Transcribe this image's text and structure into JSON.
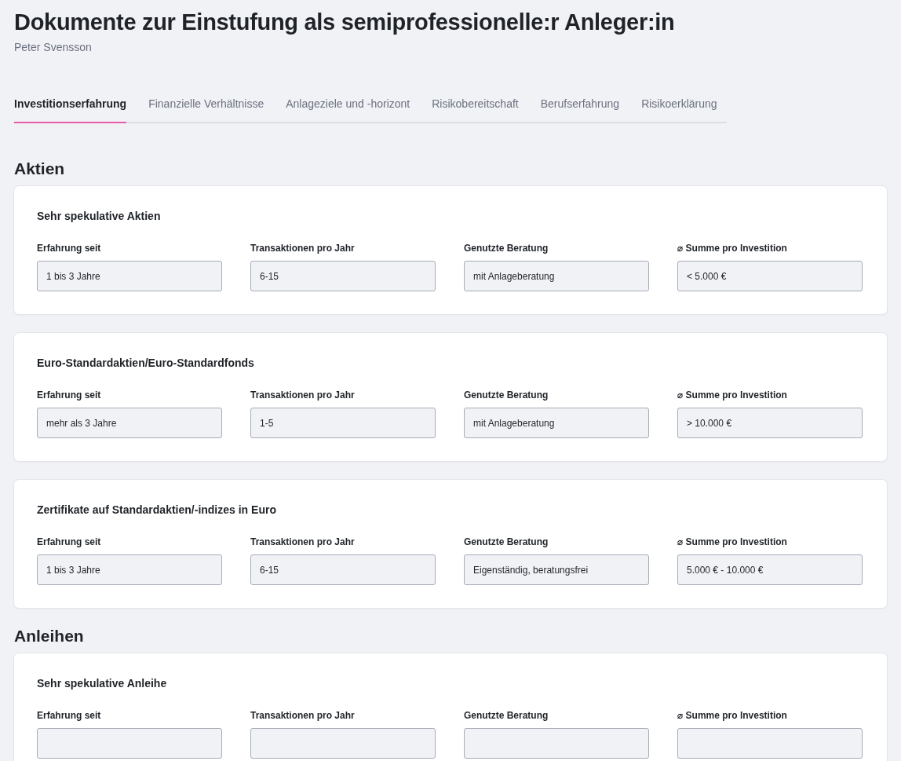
{
  "title": "Dokumente zur Einstufung als semiprofessionelle:r Anleger:in",
  "subtitle": "Peter Svensson",
  "tabs": [
    {
      "label": "Investitionserfahrung",
      "selected": true
    },
    {
      "label": "Finanzielle Verhältnisse",
      "selected": false
    },
    {
      "label": "Anlageziele und -horizont",
      "selected": false
    },
    {
      "label": "Risikobereitschaft",
      "selected": false
    },
    {
      "label": "Berufserfahrung",
      "selected": false
    },
    {
      "label": "Risikoerklärung",
      "selected": false
    }
  ],
  "sections": [
    {
      "heading": "Aktien",
      "cards": [
        {
          "title": "Sehr spekulative Aktien",
          "fields": [
            {
              "label": "Erfahrung seit",
              "value": "1 bis 3 Jahre"
            },
            {
              "label": "Transaktionen pro Jahr",
              "value": "6-15"
            },
            {
              "label": "Genutzte Beratung",
              "value": "mit Anlageberatung"
            },
            {
              "label": "⌀ Summe pro Investition",
              "value": "< 5.000 €"
            }
          ]
        },
        {
          "title": "Euro-Standardaktien/Euro-Standardfonds",
          "fields": [
            {
              "label": "Erfahrung seit",
              "value": "mehr als 3 Jahre"
            },
            {
              "label": "Transaktionen pro Jahr",
              "value": "1-5"
            },
            {
              "label": "Genutzte Beratung",
              "value": "mit Anlageberatung"
            },
            {
              "label": "⌀ Summe pro Investition",
              "value": "> 10.000 €"
            }
          ]
        },
        {
          "title": "Zertifikate auf Standardaktien/-indizes in Euro",
          "fields": [
            {
              "label": "Erfahrung seit",
              "value": "1 bis 3 Jahre"
            },
            {
              "label": "Transaktionen pro Jahr",
              "value": "6-15"
            },
            {
              "label": "Genutzte Beratung",
              "value": "Eigenständig, beratungsfrei"
            },
            {
              "label": "⌀ Summe pro Investition",
              "value": "5.000 € - 10.000 €"
            }
          ]
        }
      ]
    },
    {
      "heading": "Anleihen",
      "cards": [
        {
          "title": "Sehr spekulative Anleihe",
          "fields": [
            {
              "label": "Erfahrung seit"
            },
            {
              "label": "Transaktionen pro Jahr"
            },
            {
              "label": "Genutzte Beratung"
            },
            {
              "label": "⌀ Summe pro Investition"
            }
          ]
        }
      ]
    }
  ]
}
